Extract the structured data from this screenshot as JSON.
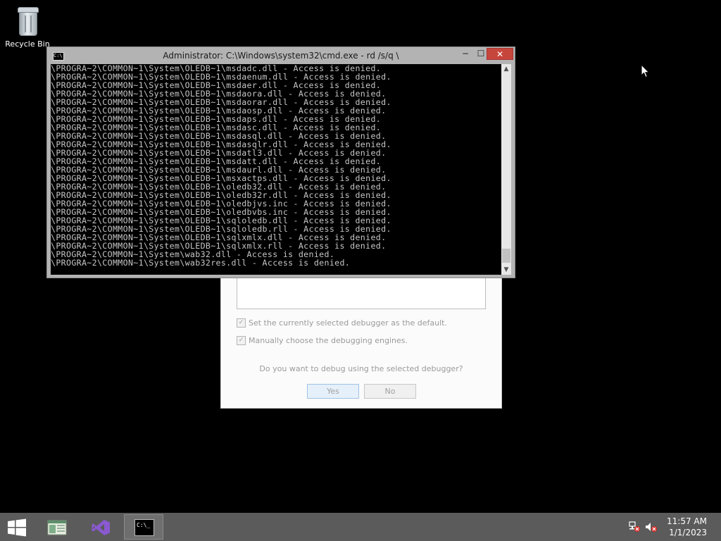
{
  "desktop": {
    "icons": [
      {
        "label": "Recycle Bin",
        "icon": "recycle-bin-icon"
      }
    ]
  },
  "dialog": {
    "checkbox_default": "Set the currently selected debugger as the default.",
    "checkbox_engines": "Manually choose the debugging engines.",
    "question": "Do you want to debug using the selected debugger?",
    "yes_label": "Yes",
    "no_label": "No"
  },
  "cmd": {
    "icon_text": "C:\\",
    "title": "Administrator: C:\\Windows\\system32\\cmd.exe - rd /s/q \\",
    "minimize": "−",
    "maximize": "☐",
    "close": "✕",
    "lines": [
      "\\PROGRA~2\\COMMON~1\\System\\OLEDB~1\\msdadc.dll - Access is denied.",
      "\\PROGRA~2\\COMMON~1\\System\\OLEDB~1\\msdaenum.dll - Access is denied.",
      "\\PROGRA~2\\COMMON~1\\System\\OLEDB~1\\msdaer.dll - Access is denied.",
      "\\PROGRA~2\\COMMON~1\\System\\OLEDB~1\\msdaora.dll - Access is denied.",
      "\\PROGRA~2\\COMMON~1\\System\\OLEDB~1\\msdaorar.dll - Access is denied.",
      "\\PROGRA~2\\COMMON~1\\System\\OLEDB~1\\msdaosp.dll - Access is denied.",
      "\\PROGRA~2\\COMMON~1\\System\\OLEDB~1\\msdaps.dll - Access is denied.",
      "\\PROGRA~2\\COMMON~1\\System\\OLEDB~1\\msdasc.dll - Access is denied.",
      "\\PROGRA~2\\COMMON~1\\System\\OLEDB~1\\msdasql.dll - Access is denied.",
      "\\PROGRA~2\\COMMON~1\\System\\OLEDB~1\\msdasqlr.dll - Access is denied.",
      "\\PROGRA~2\\COMMON~1\\System\\OLEDB~1\\msdatl3.dll - Access is denied.",
      "\\PROGRA~2\\COMMON~1\\System\\OLEDB~1\\msdatt.dll - Access is denied.",
      "\\PROGRA~2\\COMMON~1\\System\\OLEDB~1\\msdaurl.dll - Access is denied.",
      "\\PROGRA~2\\COMMON~1\\System\\OLEDB~1\\msxactps.dll - Access is denied.",
      "\\PROGRA~2\\COMMON~1\\System\\OLEDB~1\\oledb32.dll - Access is denied.",
      "\\PROGRA~2\\COMMON~1\\System\\OLEDB~1\\oledb32r.dll - Access is denied.",
      "\\PROGRA~2\\COMMON~1\\System\\OLEDB~1\\oledbjvs.inc - Access is denied.",
      "\\PROGRA~2\\COMMON~1\\System\\OLEDB~1\\oledbvbs.inc - Access is denied.",
      "\\PROGRA~2\\COMMON~1\\System\\OLEDB~1\\sqloledb.dll - Access is denied.",
      "\\PROGRA~2\\COMMON~1\\System\\OLEDB~1\\sqloledb.rll - Access is denied.",
      "\\PROGRA~2\\COMMON~1\\System\\OLEDB~1\\sqlxmlx.dll - Access is denied.",
      "\\PROGRA~2\\COMMON~1\\System\\OLEDB~1\\sqlxmlx.rll - Access is denied.",
      "\\PROGRA~2\\COMMON~1\\System\\wab32.dll - Access is denied.",
      "\\PROGRA~2\\COMMON~1\\System\\wab32res.dll - Access is denied."
    ]
  },
  "taskbar": {
    "start_icon": "windows-start-icon",
    "apps": [
      {
        "name": "explorer",
        "icon": "file-explorer-icon",
        "active": false
      },
      {
        "name": "visual-studio",
        "icon": "visual-studio-icon",
        "active": false
      },
      {
        "name": "command-prompt",
        "icon": "command-prompt-icon",
        "active": true,
        "icon_text": "C:\\_"
      }
    ],
    "tray": [
      "network-error-icon",
      "volume-muted-icon"
    ],
    "time": "11:57 AM",
    "date": "1/1/2023"
  },
  "colors": {
    "desktop": "#000000",
    "taskbar": "#5b5b5b",
    "console_text": "#c6c6c6",
    "close_button": "#c7463c"
  }
}
